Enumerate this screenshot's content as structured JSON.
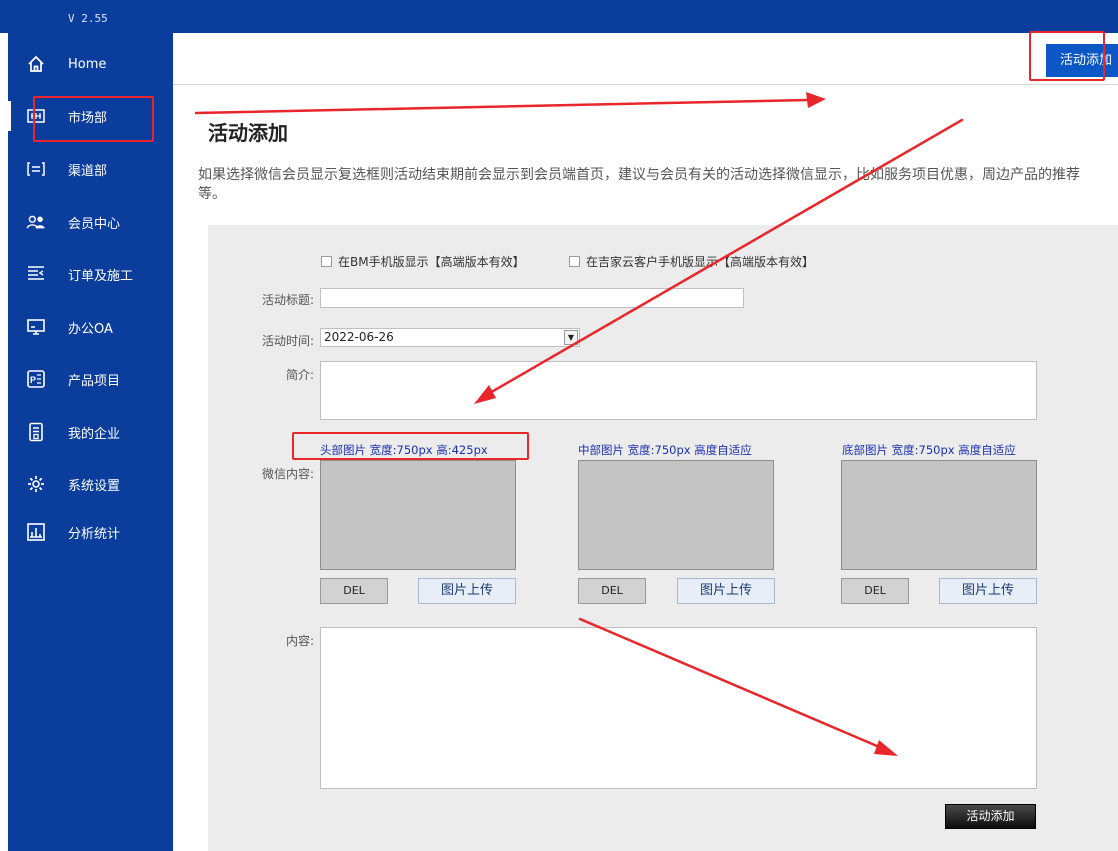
{
  "app": {
    "version": "V 2.55"
  },
  "sidebar": {
    "items": [
      {
        "label": "Home",
        "icon": "home-icon"
      },
      {
        "label": "市场部",
        "icon": "market-icon"
      },
      {
        "label": "渠道部",
        "icon": "channel-icon"
      },
      {
        "label": "会员中心",
        "icon": "members-icon"
      },
      {
        "label": "订单及施工",
        "icon": "orders-icon"
      },
      {
        "label": "办公OA",
        "icon": "office-icon"
      },
      {
        "label": "产品项目",
        "icon": "product-icon"
      },
      {
        "label": "我的企业",
        "icon": "enterprise-icon"
      },
      {
        "label": "系统设置",
        "icon": "settings-icon"
      },
      {
        "label": "分析统计",
        "icon": "analytics-icon"
      }
    ]
  },
  "header": {
    "button_label": "活动添加"
  },
  "page": {
    "title": "活动添加",
    "description": "如果选择微信会员显示复选框则活动结束期前会显示到会员端首页，建议与会员有关的活动选择微信显示，比如服务项目优惠，周边产品的推荐等。"
  },
  "form": {
    "checkbox_bm": "在BM手机版显示【高端版本有效】",
    "checkbox_cloud": "在吉家云客户手机版显示【高端版本有效】",
    "title_label": "活动标题:",
    "title_value": "",
    "time_label": "活动时间:",
    "time_value": "2022-06-26",
    "intro_label": "简介:",
    "wechat_label": "微信内容:",
    "images": [
      {
        "caption": "头部图片 宽度:750px 高:425px",
        "del": "DEL",
        "upload": "图片上传"
      },
      {
        "caption": "中部图片 宽度:750px  高度自适应",
        "del": "DEL",
        "upload": "图片上传"
      },
      {
        "caption": "底部图片 宽度:750px  高度自适应",
        "del": "DEL",
        "upload": "图片上传"
      }
    ],
    "content_label": "内容:",
    "submit_label": "活动添加"
  },
  "colors": {
    "sidebar": "#0a3d9c",
    "accent": "#0b57c5",
    "annotation": "#e8262b"
  }
}
